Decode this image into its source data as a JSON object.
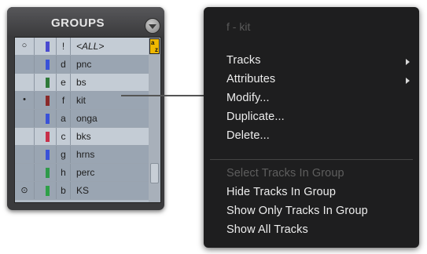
{
  "groups_panel": {
    "title": "GROUPS",
    "rows": [
      {
        "status": "○",
        "color": "#4a4ad0",
        "id": "!",
        "name": "<ALL>",
        "italic": true
      },
      {
        "status": "",
        "color": "#3a52d8",
        "id": "d",
        "name": "pnc"
      },
      {
        "status": "",
        "color": "#2f7a3a",
        "id": "e",
        "name": "bs"
      },
      {
        "status": "•",
        "color": "#8a2a2a",
        "id": "f",
        "name": "kit"
      },
      {
        "status": "",
        "color": "#3a52d8",
        "id": "a",
        "name": "onga"
      },
      {
        "status": "",
        "color": "#c8304a",
        "id": "c",
        "name": "bks"
      },
      {
        "status": "",
        "color": "#3a52d8",
        "id": "g",
        "name": "hrns"
      },
      {
        "status": "",
        "color": "#2f9a4a",
        "id": "h",
        "name": "perc"
      },
      {
        "status": "⊙",
        "color": "#2fa048",
        "id": "b",
        "name": "KS"
      }
    ],
    "scroll_badge": {
      "top": "a",
      "bottom": "z"
    }
  },
  "context_menu": {
    "title": "f - kit",
    "items": [
      {
        "label": "Tracks",
        "submenu": true,
        "enabled": true
      },
      {
        "label": "Attributes",
        "submenu": true,
        "enabled": true
      },
      {
        "label": "Modify...",
        "submenu": false,
        "enabled": true
      },
      {
        "label": "Duplicate...",
        "submenu": false,
        "enabled": true
      },
      {
        "label": "Delete...",
        "submenu": false,
        "enabled": true
      },
      {
        "label": "Select Tracks In Group",
        "submenu": false,
        "enabled": false
      },
      {
        "label": "Hide Tracks In Group",
        "submenu": false,
        "enabled": true
      },
      {
        "label": "Show Only Tracks In Group",
        "submenu": false,
        "enabled": true
      },
      {
        "label": "Show All Tracks",
        "submenu": false,
        "enabled": true
      }
    ]
  }
}
